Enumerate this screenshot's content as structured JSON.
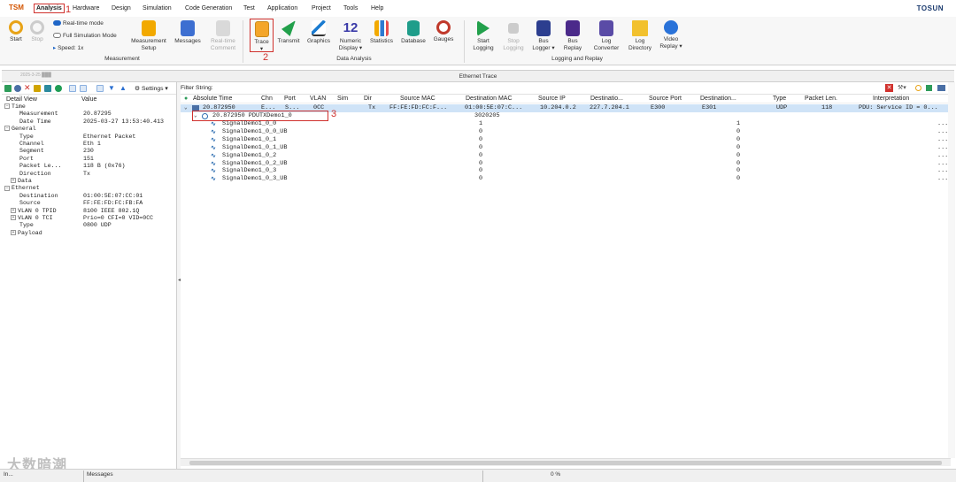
{
  "app": {
    "brand": "TOSUN",
    "icon": "TSM"
  },
  "menu": {
    "items": [
      "Analysis",
      "Hardware",
      "Design",
      "Simulation",
      "Code Generation",
      "Test",
      "Application",
      "Project",
      "Tools",
      "Help"
    ],
    "annot1": "1"
  },
  "ribbon": {
    "start": "Start",
    "stop": "Stop",
    "realtime": "Real-time mode",
    "fullsim": "Full Simulation Mode",
    "speed": "Speed: 1x",
    "meas_setup": [
      "Measurement",
      "Setup"
    ],
    "messages": "Messages",
    "realtime_comment": [
      "Real-time",
      "Comment"
    ],
    "trace": "Trace",
    "annot2": "2",
    "transmit": "Transmit",
    "graphics": "Graphics",
    "numeric": [
      "Numeric",
      "Display ▾"
    ],
    "numeric_glyph": "12",
    "statistics": "Statistics",
    "database": "Database",
    "gauges": "Gauges",
    "start_logging": [
      "Start",
      "Logging"
    ],
    "stop_logging": [
      "Stop",
      "Logging"
    ],
    "bus_logger": [
      "Bus",
      "Logger ▾"
    ],
    "bus_replay": [
      "Bus",
      "Replay"
    ],
    "log_converter": [
      "Log",
      "Converter"
    ],
    "log_directory": [
      "Log",
      "Directory"
    ],
    "video_replay": [
      "Video",
      "Replay ▾"
    ],
    "groups": {
      "measurement": "Measurement",
      "data_analysis": "Data Analysis",
      "logging": "Logging and Replay"
    }
  },
  "window": {
    "title": "Ethernet Trace",
    "caption": "2025-3-25 ███"
  },
  "left": {
    "settings": "Settings ▾",
    "hdr_detail": "Detail View",
    "hdr_value": "Value",
    "rows": [
      {
        "k": "Time",
        "v": "",
        "lvl": 0,
        "exp": "−"
      },
      {
        "k": "Measurement",
        "v": "20.87295",
        "lvl": 2
      },
      {
        "k": "Date Time",
        "v": "2025-03-27 13:53:40.413",
        "lvl": 2
      },
      {
        "k": "General",
        "v": "",
        "lvl": 0,
        "exp": "−"
      },
      {
        "k": "Type",
        "v": "Ethernet Packet",
        "lvl": 2
      },
      {
        "k": "Channel",
        "v": "Eth 1",
        "lvl": 2
      },
      {
        "k": "Segment",
        "v": "230",
        "lvl": 2
      },
      {
        "k": "Port",
        "v": "151",
        "lvl": 2
      },
      {
        "k": "Packet Le...",
        "v": "118 B (0x76)",
        "lvl": 2
      },
      {
        "k": "Direction",
        "v": "Tx",
        "lvl": 2
      },
      {
        "k": "Data",
        "v": "",
        "lvl": 1,
        "exp": "+"
      },
      {
        "k": "Ethernet",
        "v": "",
        "lvl": 0,
        "exp": "−"
      },
      {
        "k": "Destination",
        "v": "01:00:5E:07:CC:01",
        "lvl": 2
      },
      {
        "k": "Source",
        "v": "FF:FE:FD:FC:FB:FA",
        "lvl": 2
      },
      {
        "k": "VLAN 0 TPID",
        "v": "8100 IEEE 802.1Q",
        "lvl": 1,
        "exp": "+"
      },
      {
        "k": "VLAN 0 TCI",
        "v": "Prio=0 CFI=0 VID=0CC",
        "lvl": 1,
        "exp": "+"
      },
      {
        "k": "Type",
        "v": "0800 UDP",
        "lvl": 2
      },
      {
        "k": "Payload",
        "v": "",
        "lvl": 1,
        "exp": "+"
      }
    ]
  },
  "right": {
    "filter_label": "Filter String:",
    "columns": [
      "Absolute Time",
      "Chn",
      "Port",
      "VLAN",
      "Sim",
      "Dir",
      "Source MAC",
      "Destination MAC",
      "Source IP",
      "Destinatio...",
      "Source Port",
      "Destination...",
      "Type",
      "Packet Len.",
      "Interpretation"
    ],
    "packet": {
      "time": "20.872950",
      "chn": "E...",
      "port": "S...",
      "vlan": "0CC",
      "sim": "",
      "dir": "Tx",
      "src_mac": "FF:FE:FD:FC:F...",
      "dst_mac": "01:00:5E:07:C...",
      "src_ip": "10.204.0.2",
      "dst_ip": "227.7.204.1",
      "src_port": "E300",
      "dst_port": "E301",
      "type": "UDP",
      "len": "118",
      "interp": "PDU: Service ID = 0..."
    },
    "pdu": {
      "label": "20.872950 PDUTXDemo1_0",
      "value": "3020205",
      "annot3": "3"
    },
    "signals": [
      {
        "name": "SignalDemo1_0_0",
        "raw": "1",
        "phys": "1"
      },
      {
        "name": "SignalDemo1_0_0_UB",
        "raw": "0",
        "phys": "0"
      },
      {
        "name": "SignalDemo1_0_1",
        "raw": "0",
        "phys": "0"
      },
      {
        "name": "SignalDemo1_0_1_UB",
        "raw": "0",
        "phys": "0"
      },
      {
        "name": "SignalDemo1_0_2",
        "raw": "0",
        "phys": "0"
      },
      {
        "name": "SignalDemo1_0_2_UB",
        "raw": "0",
        "phys": "0"
      },
      {
        "name": "SignalDemo1_0_3",
        "raw": "0",
        "phys": "0"
      },
      {
        "name": "SignalDemo1_0_3_UB",
        "raw": "0",
        "phys": "0"
      }
    ],
    "ellipsis": "..."
  },
  "status": {
    "left": "In...",
    "mid": "Messages",
    "progress": "0 %"
  },
  "watermark": "大数暗潮"
}
